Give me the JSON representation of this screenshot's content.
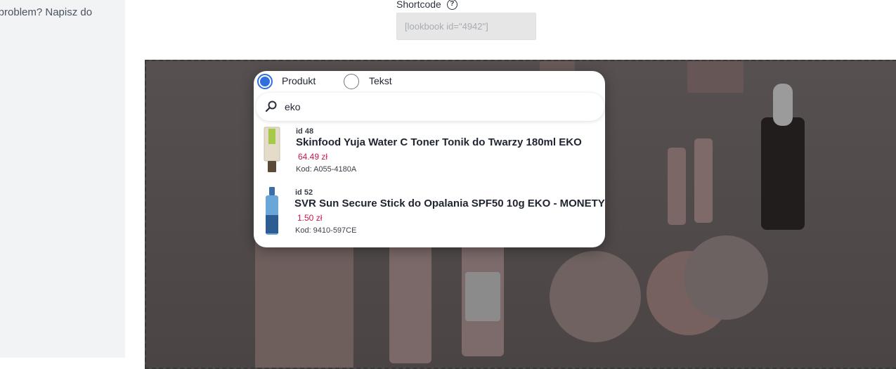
{
  "sidebar": {
    "help_text": "z problem? Napisz do"
  },
  "shortcode": {
    "label": "Shortcode",
    "help_icon": "?",
    "value": "[lookbook id=\"4942\"]"
  },
  "popup": {
    "radio_options": [
      {
        "label": "Produkt",
        "selected": true
      },
      {
        "label": "Tekst",
        "selected": false
      }
    ],
    "search": {
      "value": "eko",
      "icon": "search-icon"
    },
    "results": [
      {
        "id": "id 48",
        "name": "Skinfood Yuja Water C Toner Tonik do Twarzy 180ml EKO",
        "price": "64.49 zł",
        "code": "Kod: A055-4180A"
      },
      {
        "id": "id 52",
        "name": "SVR Sun Secure Stick do Opalania SPF50 10g EKO - MONETY",
        "price": "1.50 zł",
        "code": "Kod: 9410-597CE"
      }
    ]
  },
  "colors": {
    "accent": "#2f6fe0",
    "price": "#c8174a",
    "sidebar_bg": "#f1f3f5",
    "canvas_overlay": "#4e4848"
  }
}
